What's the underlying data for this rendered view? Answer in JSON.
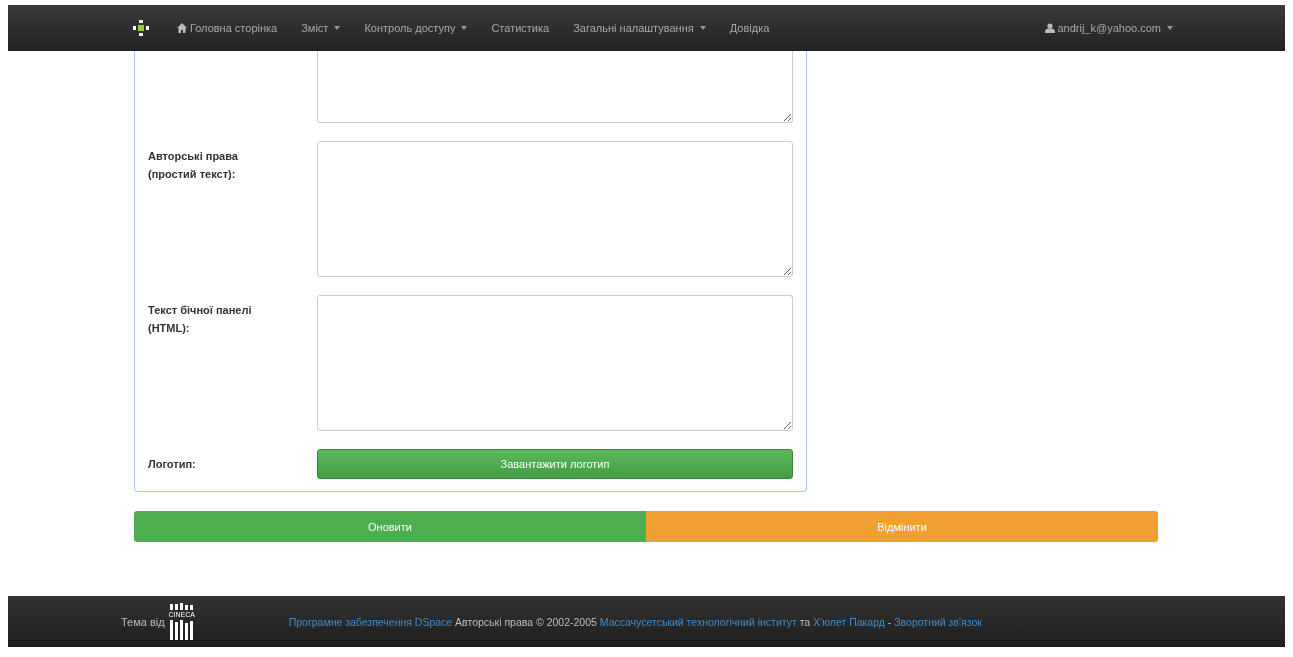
{
  "navbar": {
    "items": [
      {
        "label": "Головна сторінка",
        "dropdown": false
      },
      {
        "label": "Зміст",
        "dropdown": true
      },
      {
        "label": "Контроль доступу",
        "dropdown": true
      },
      {
        "label": "Статистика",
        "dropdown": false
      },
      {
        "label": "Загальні налаштування",
        "dropdown": true
      },
      {
        "label": "Довідка",
        "dropdown": false
      }
    ],
    "user": {
      "label": "andrij_k@yahoo.com",
      "dropdown": true
    }
  },
  "form": {
    "fields": [
      {
        "kind": "textarea"
      },
      {
        "kind": "textarea",
        "label": "Авторські права (простий текст):"
      },
      {
        "kind": "textarea",
        "label": "Текст бічної панелі (HTML):"
      },
      {
        "kind": "upload",
        "label": "Логотип:",
        "button": "Завантажити логотип"
      }
    ]
  },
  "actions": [
    {
      "label": "Оновити",
      "kind": "primary"
    },
    {
      "label": "Відмінити",
      "kind": "warning"
    }
  ],
  "footer": {
    "theme_label": "Тема від",
    "logo_text": "CINECA",
    "parts": [
      {
        "text": "Програмне забезпечення DSpace",
        "link": true
      },
      {
        "text": " Авторські права © 2002-2005 ",
        "link": false
      },
      {
        "text": "Массачусетський технологічний інститут",
        "link": true
      },
      {
        "text": " та ",
        "link": false
      },
      {
        "text": "Х'юлет Пакард",
        "link": true
      },
      {
        "text": " - ",
        "link": false
      },
      {
        "text": "Зворотний зв'язок",
        "link": true
      }
    ]
  }
}
